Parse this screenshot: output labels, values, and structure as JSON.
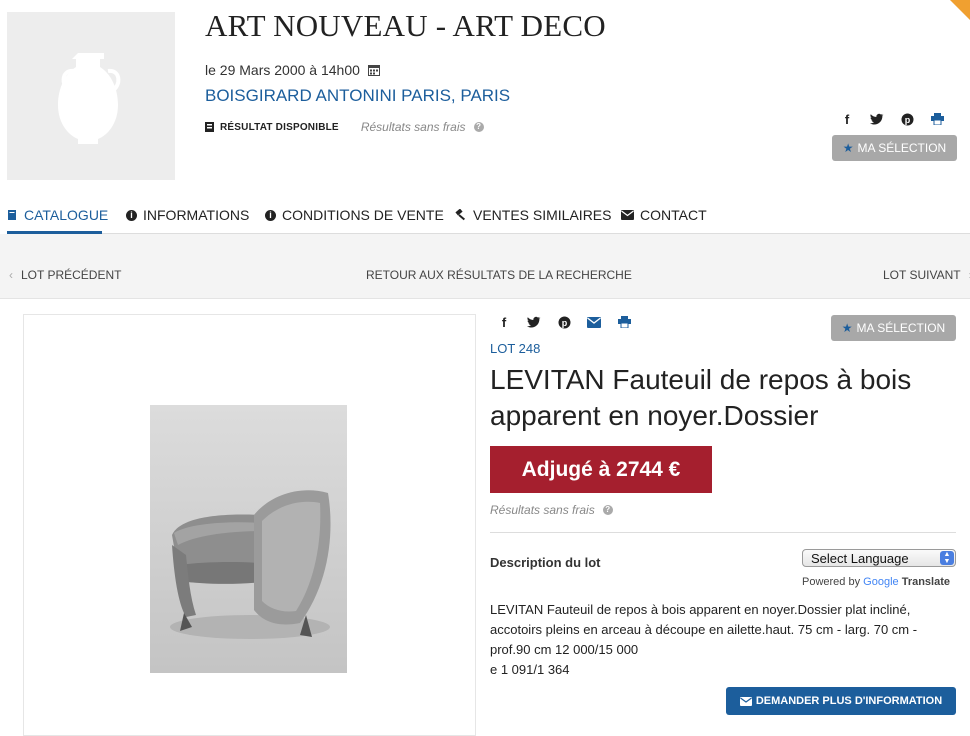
{
  "sale": {
    "title": "ART NOUVEAU - ART DECO",
    "date": "le 29 Mars 2000 à 14h00",
    "auction_house": "BOISGIRARD ANTONINI PARIS, PARIS",
    "result_available": "RÉSULTAT DISPONIBLE",
    "results_note": "Résultats sans frais",
    "selection_label": "MA SÉLECTION"
  },
  "tabs": [
    {
      "label": "CATALOGUE",
      "icon": "book-icon",
      "active": true
    },
    {
      "label": "INFORMATIONS",
      "icon": "info-icon",
      "active": false
    },
    {
      "label": "CONDITIONS DE VENTE",
      "icon": "info-icon",
      "active": false
    },
    {
      "label": "VENTES SIMILAIRES",
      "icon": "gavel-icon",
      "active": false
    },
    {
      "label": "CONTACT",
      "icon": "envelope-icon",
      "active": false
    }
  ],
  "nav": {
    "prev": "LOT PRÉCÉDENT",
    "back": "RETOUR AUX RÉSULTATS DE LA RECHERCHE",
    "next": "LOT SUIVANT"
  },
  "lot": {
    "number": "LOT 248",
    "title": "LEVITAN Fauteuil de repos à bois apparent en noyer.Dossier",
    "sold_label": "Adjugé à 2744 €",
    "results_note": "Résultats sans frais",
    "selection_label": "MA SÉLECTION",
    "description_heading": "Description du lot",
    "description_lines": [
      "LEVITAN Fauteuil de repos à bois apparent en noyer.Dossier plat incliné,",
      "accotoirs pleins en arceau à découpe en ailette.haut. 75 cm - larg. 70 cm -",
      "prof.90 cm 12 000/15 000",
      "e 1 091/1 364"
    ],
    "request_info": "DEMANDER PLUS D'INFORMATION"
  },
  "translate": {
    "select_label": "Select Language",
    "powered_by": "Powered by",
    "google": "Google",
    "translate": "Translate"
  },
  "share_icons": [
    "facebook-icon",
    "twitter-icon",
    "pinterest-icon",
    "print-icon"
  ],
  "colors": {
    "accent_blue": "#1c5e9c",
    "sold_red": "#a51f2e",
    "selection_gray": "#a8a8a8"
  }
}
